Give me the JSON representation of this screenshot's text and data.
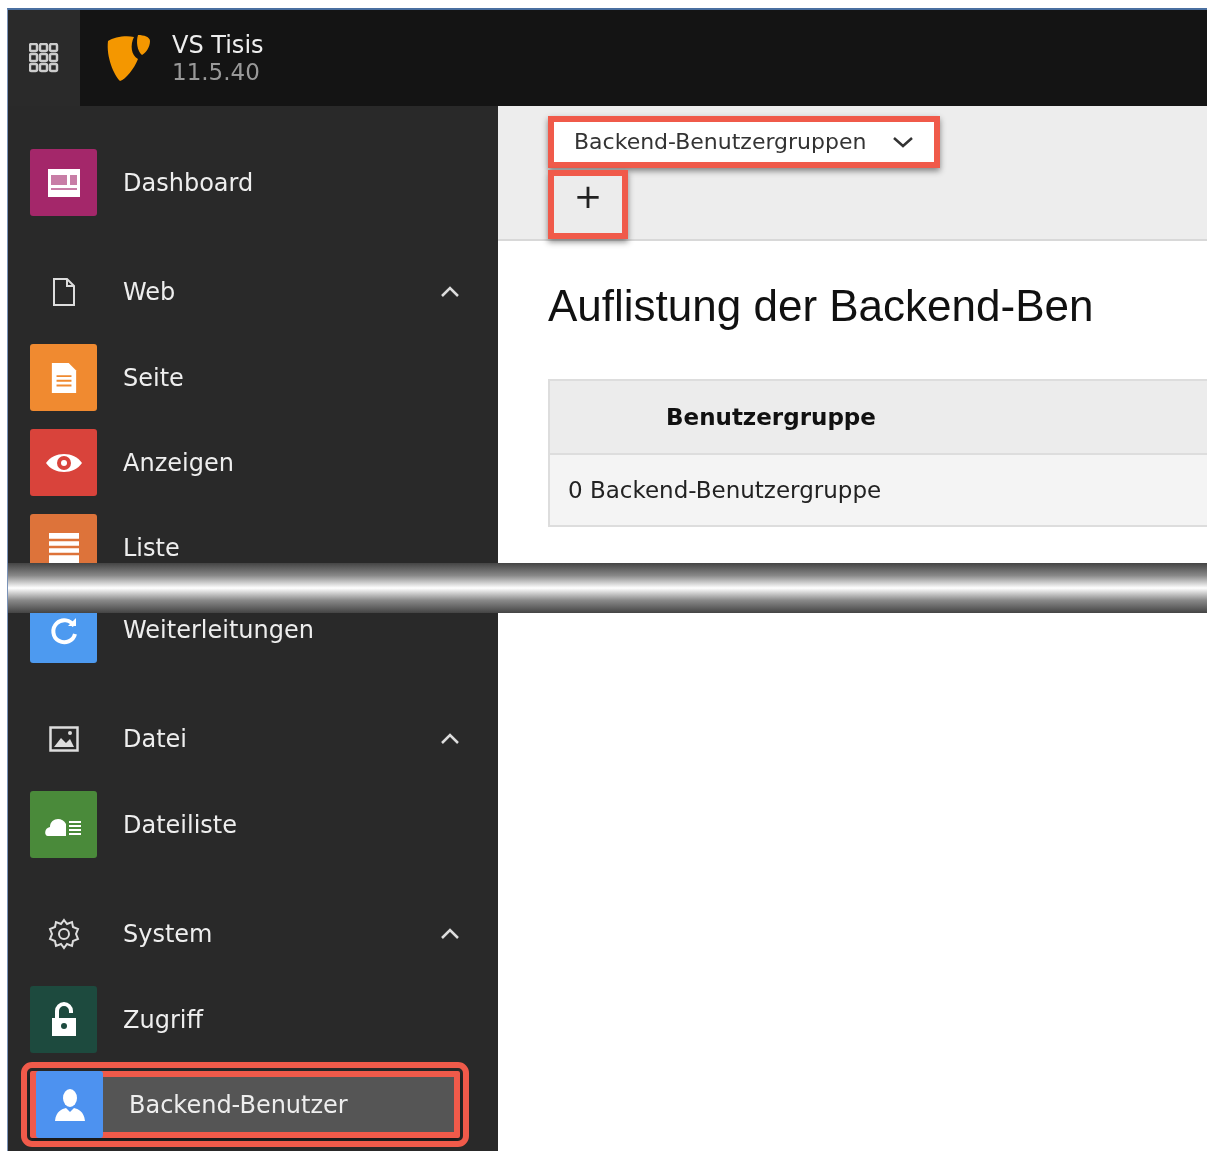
{
  "topbar": {
    "site_name": "VS Tisis",
    "version": "11.5.40"
  },
  "sidebar": {
    "sections": [
      {
        "items": [
          {
            "kind": "module",
            "label": "Dashboard",
            "color": "#a4276a",
            "selected": false,
            "highlighted": false
          },
          {
            "kind": "group",
            "label": "Web",
            "expanded": true
          },
          {
            "kind": "module",
            "label": "Seite",
            "color": "#f08a30",
            "selected": false,
            "highlighted": false
          },
          {
            "kind": "module",
            "label": "Anzeigen",
            "color": "#d9433b",
            "selected": false,
            "highlighted": false
          },
          {
            "kind": "module",
            "label": "Liste",
            "color": "#dd733a",
            "selected": false,
            "highlighted": false
          }
        ]
      },
      {
        "items": [
          {
            "kind": "module",
            "label": "Weiterleitungen",
            "color": "#4d9af0",
            "selected": false,
            "highlighted": false
          },
          {
            "kind": "group",
            "label": "Datei",
            "expanded": true
          },
          {
            "kind": "module",
            "label": "Dateiliste",
            "color": "#4a8a3a",
            "selected": false,
            "highlighted": false
          },
          {
            "kind": "group",
            "label": "System",
            "expanded": true
          },
          {
            "kind": "module",
            "label": "Zugriff",
            "color": "#1d4a3e",
            "selected": false,
            "highlighted": false
          },
          {
            "kind": "module",
            "label": "Backend-Benutzer",
            "color": "#4d92f0",
            "selected": true,
            "highlighted": true
          }
        ]
      }
    ]
  },
  "toolbar": {
    "view_select": {
      "value": "Backend-Benutzergruppen",
      "highlighted": true
    },
    "add_button": {
      "label": "+",
      "highlighted": true
    }
  },
  "content": {
    "heading": "Auflistung der Backend-Ben",
    "table": {
      "columns": [
        "Benutzergruppe"
      ],
      "rows": [
        [
          "0 Backend-Benutzergruppe"
        ]
      ]
    }
  }
}
